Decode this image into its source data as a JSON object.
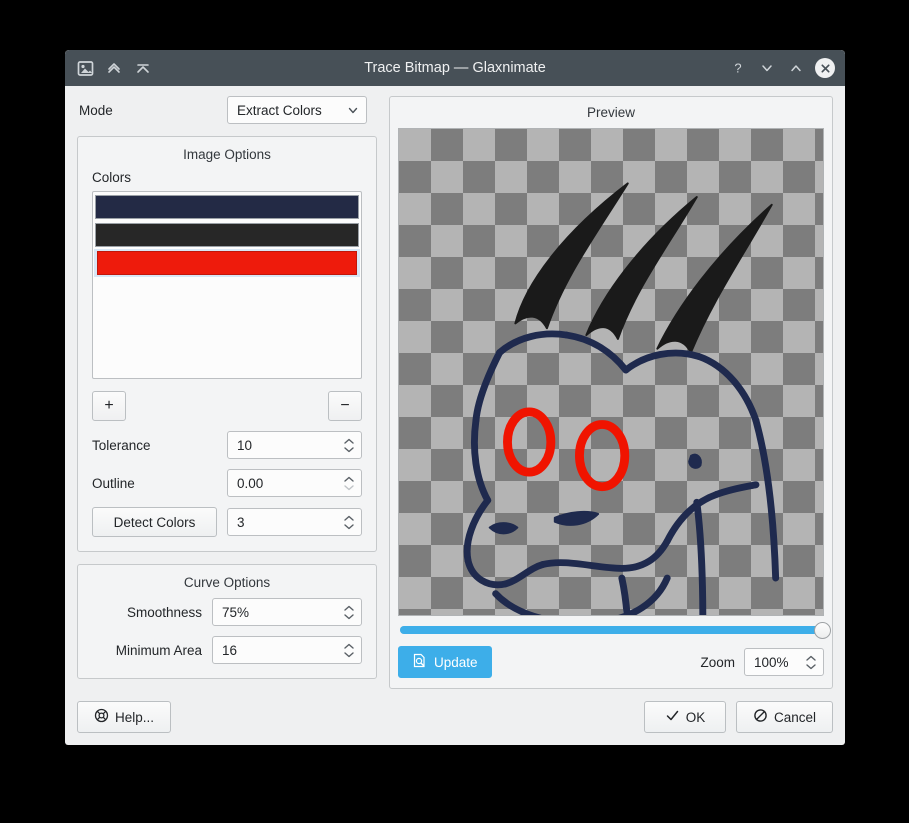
{
  "window": {
    "title": "Trace Bitmap — Glaxnimate",
    "titlebar": {
      "app_icon": "image-document-icon",
      "keep_above_icon": "keep-above-icon",
      "shade_icon": "shade-icon",
      "help_icon": "help-question-icon",
      "minimize_icon": "minimize-chevron-down-icon",
      "maximize_icon": "maximize-chevron-up-icon",
      "close_icon": "close-x-icon"
    }
  },
  "mode": {
    "label": "Mode",
    "value": "Extract Colors",
    "chevron_icon": "chevron-down-icon"
  },
  "image_options": {
    "title": "Image Options",
    "colors_label": "Colors",
    "colors": [
      {
        "name": "color-swatch-navy",
        "hex": "#232a45",
        "selected": false
      },
      {
        "name": "color-swatch-charcoal",
        "hex": "#272727",
        "selected": false
      },
      {
        "name": "color-swatch-red",
        "hex": "#ee1b0c",
        "selected": true
      }
    ],
    "add_label": "+",
    "remove_label": "−",
    "tolerance_label": "Tolerance",
    "tolerance_value": "10",
    "outline_label": "Outline",
    "outline_value": "0.00",
    "detect_colors_label": "Detect Colors",
    "detect_colors_value": "3"
  },
  "curve_options": {
    "title": "Curve Options",
    "smoothness_label": "Smoothness",
    "smoothness_value": "75%",
    "minimum_area_label": "Minimum Area",
    "minimum_area_value": "16"
  },
  "preview": {
    "title": "Preview",
    "progress_percent": 100,
    "update_label": "Update",
    "update_icon": "document-preview-icon",
    "zoom_label": "Zoom",
    "zoom_value": "100%",
    "artwork": {
      "description": "Line-art dragon head traced from bitmap",
      "stroke_navy": "#1f2a4e",
      "stroke_black": "#1a1a1a",
      "stroke_red": "#f01400",
      "checker_light": "#b4b4b4",
      "checker_dark": "#7d7d7d"
    }
  },
  "footer": {
    "help_label": "Help...",
    "help_icon": "lifebuoy-icon",
    "ok_label": "OK",
    "ok_icon": "check-icon",
    "cancel_label": "Cancel",
    "cancel_icon": "no-entry-icon"
  }
}
